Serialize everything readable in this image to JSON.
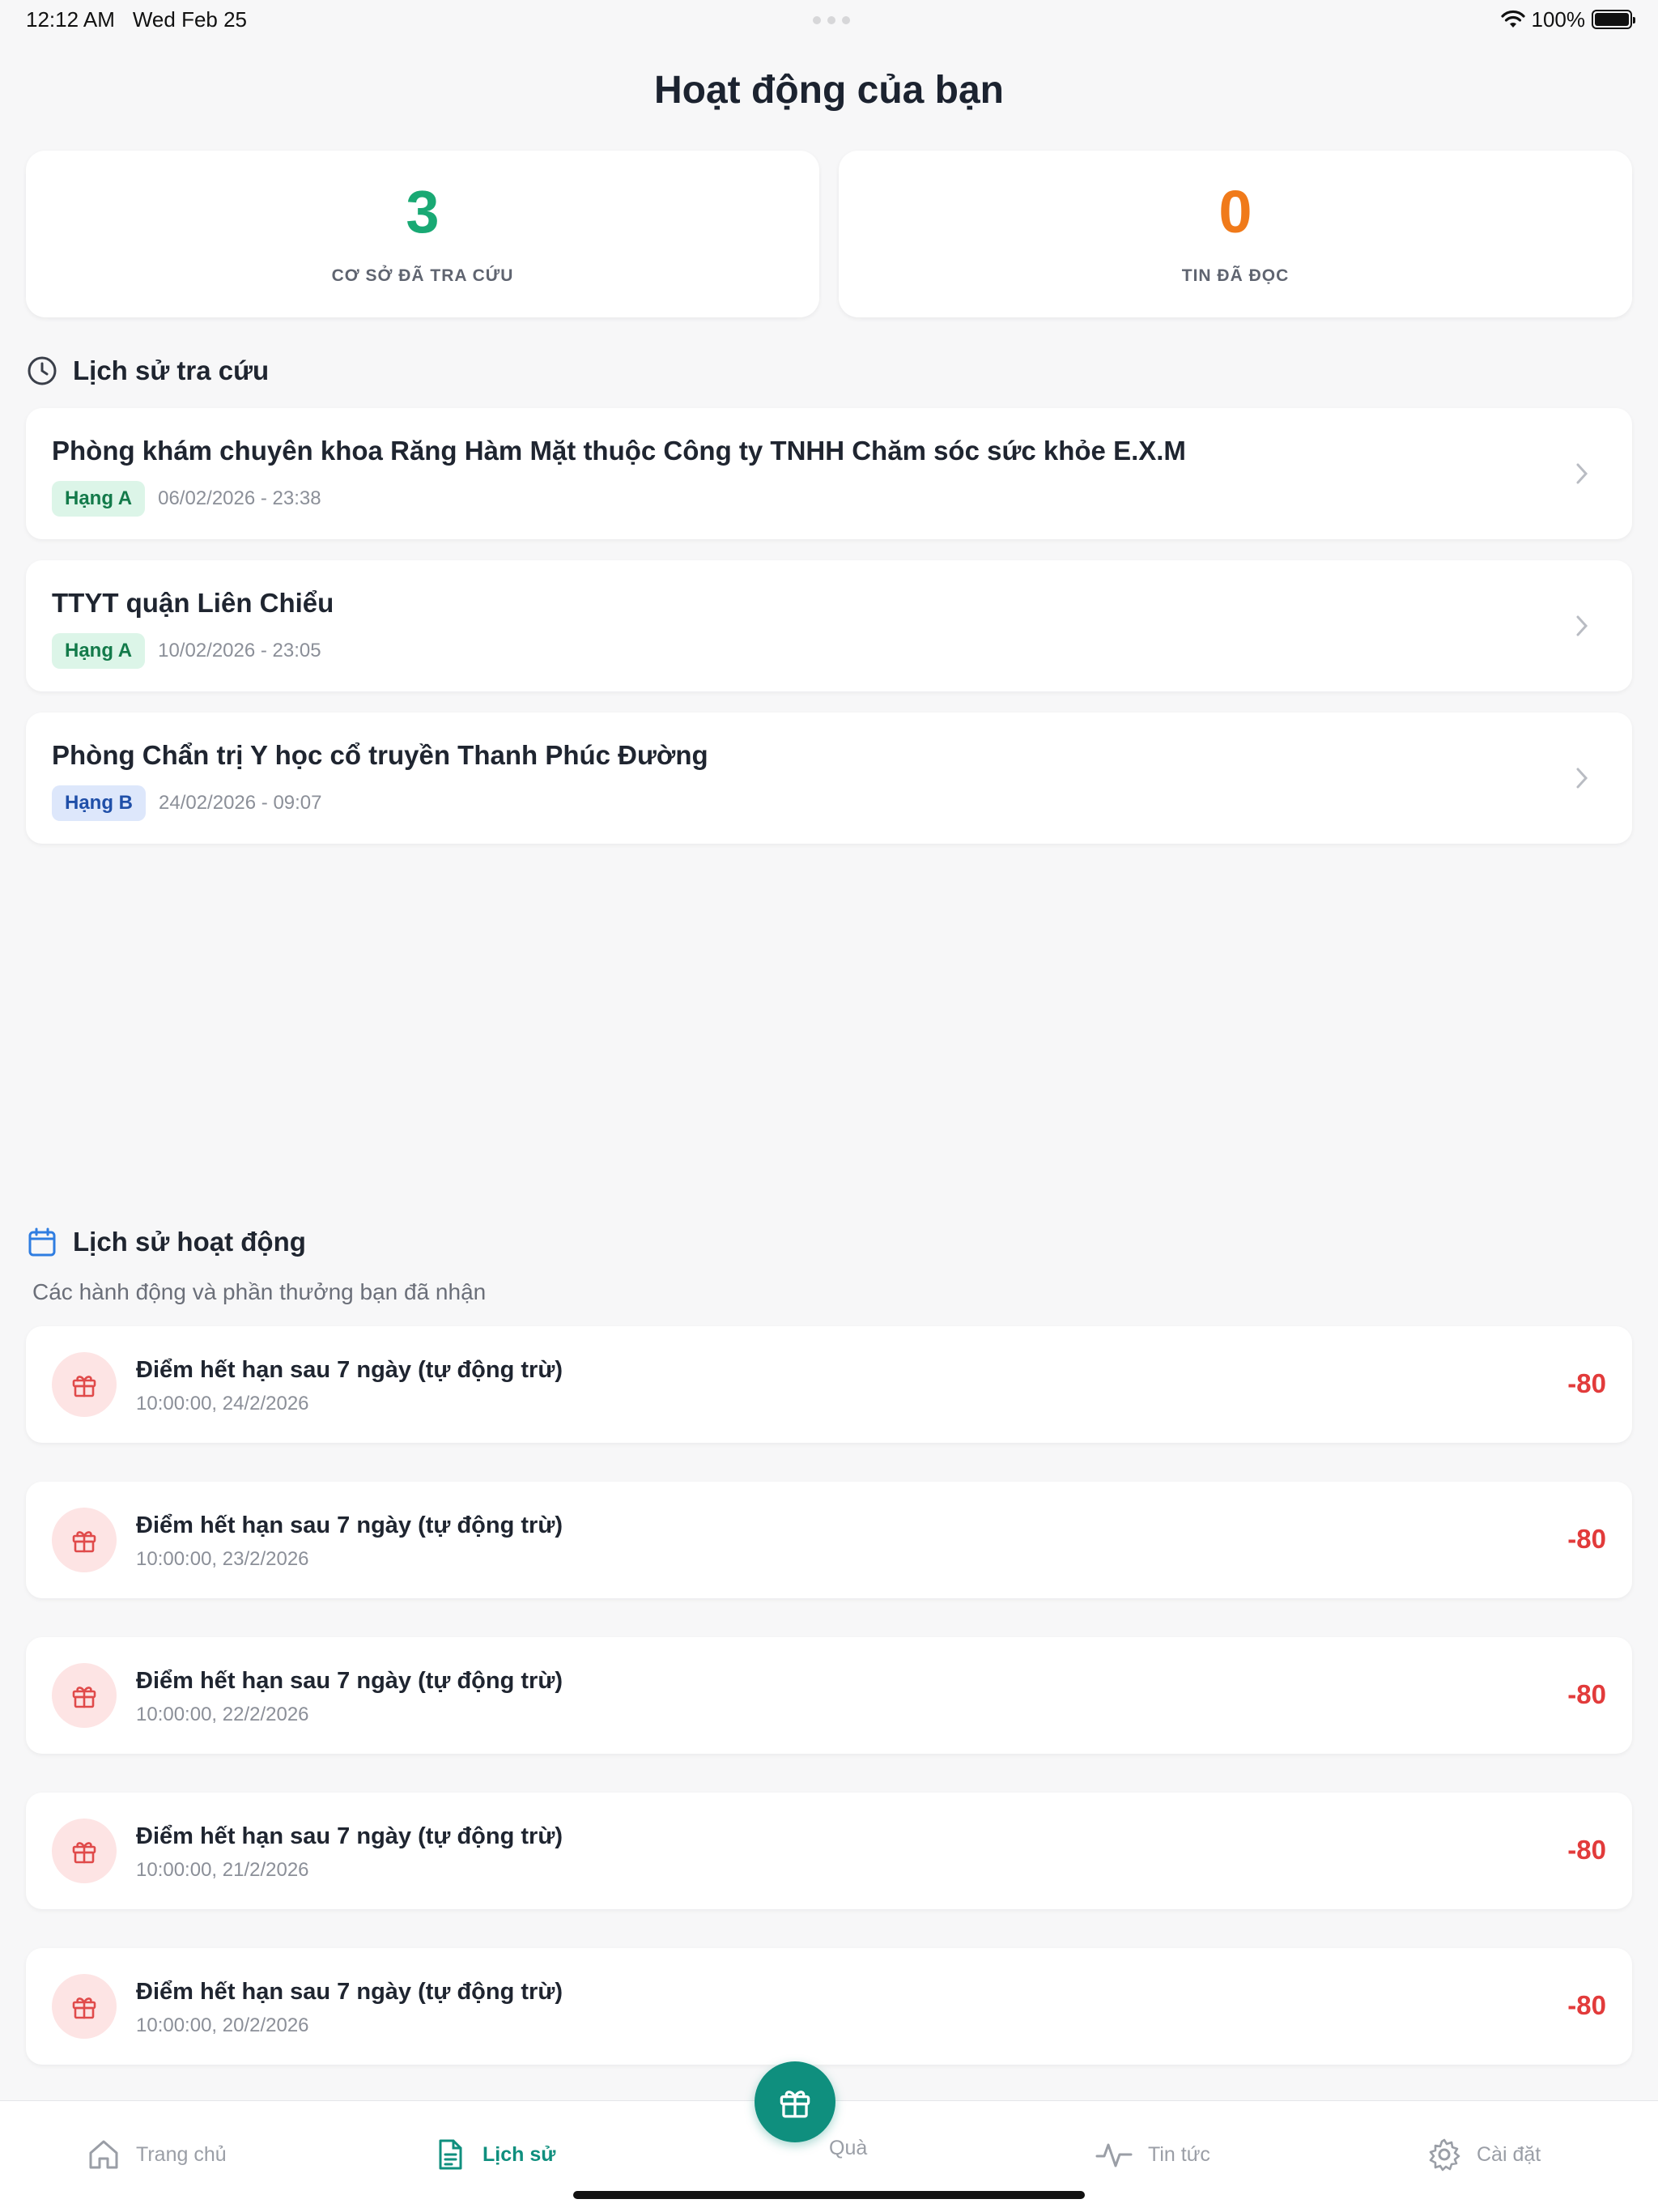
{
  "status_bar": {
    "time": "12:12 AM",
    "date": "Wed Feb 25",
    "battery": "100%"
  },
  "page_title": "Hoạt động của bạn",
  "stats": [
    {
      "value": "3",
      "label": "CƠ SỞ ĐÃ TRA CỨU",
      "color": "#19a974"
    },
    {
      "value": "0",
      "label": "TIN ĐÃ ĐỌC",
      "color": "#f07a1a"
    }
  ],
  "search_history": {
    "title": "Lịch sử tra cứu",
    "items": [
      {
        "name": "Phòng khám chuyên khoa Răng Hàm Mặt thuộc Công ty TNHH Chăm sóc sức khỏe E.X.M",
        "rank": "Hạng A",
        "date": "06/02/2026 - 23:38"
      },
      {
        "name": "TTYT quận Liên Chiểu",
        "rank": "Hạng A",
        "date": "10/02/2026 - 23:05"
      },
      {
        "name": "Phòng Chẩn trị Y học cổ truyền Thanh Phúc Đường",
        "rank": "Hạng B",
        "date": "24/02/2026 - 09:07"
      }
    ]
  },
  "activity_history": {
    "title": "Lịch sử hoạt động",
    "subtitle": "Các hành động và phần thưởng bạn đã nhận",
    "items": [
      {
        "title": "Điểm hết hạn sau 7 ngày (tự động trừ)",
        "time": "10:00:00, 24/2/2026",
        "points": "-80"
      },
      {
        "title": "Điểm hết hạn sau 7 ngày (tự động trừ)",
        "time": "10:00:00, 23/2/2026",
        "points": "-80"
      },
      {
        "title": "Điểm hết hạn sau 7 ngày (tự động trừ)",
        "time": "10:00:00, 22/2/2026",
        "points": "-80"
      },
      {
        "title": "Điểm hết hạn sau 7 ngày (tự động trừ)",
        "time": "10:00:00, 21/2/2026",
        "points": "-80"
      },
      {
        "title": "Điểm hết hạn sau 7 ngày (tự động trừ)",
        "time": "10:00:00, 20/2/2026",
        "points": "-80"
      }
    ]
  },
  "tabs": [
    {
      "label": "Trang chủ",
      "icon": "home-icon"
    },
    {
      "label": "Lịch sử",
      "icon": "document-icon",
      "active": true
    },
    {
      "label": "Quà",
      "icon": "gift-icon"
    },
    {
      "label": "Tin tức",
      "icon": "activity-icon"
    },
    {
      "label": "Cài đặt",
      "icon": "gear-icon"
    }
  ],
  "colors": {
    "accent": "#0f8f7e",
    "negative": "#e23b3b"
  }
}
